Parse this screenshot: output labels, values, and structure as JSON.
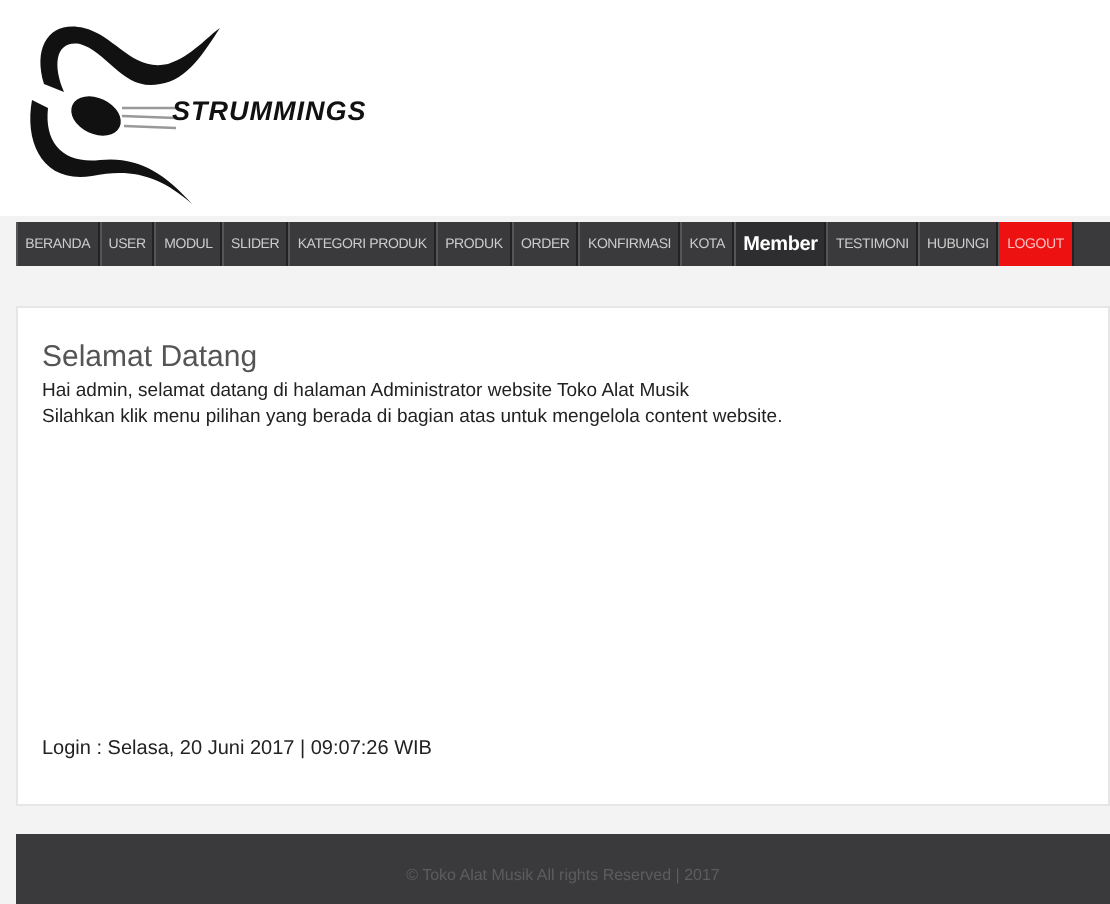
{
  "logo": {
    "text": "STRUMMINGS"
  },
  "nav": [
    {
      "label": "BERANDA",
      "selected": false,
      "kind": "link"
    },
    {
      "label": "USER",
      "selected": false,
      "kind": "link"
    },
    {
      "label": "MODUL",
      "selected": false,
      "kind": "link"
    },
    {
      "label": "SLIDER",
      "selected": false,
      "kind": "link"
    },
    {
      "label": "KATEGORI PRODUK",
      "selected": false,
      "kind": "link"
    },
    {
      "label": "PRODUK",
      "selected": false,
      "kind": "link"
    },
    {
      "label": "ORDER",
      "selected": false,
      "kind": "link"
    },
    {
      "label": "KONFIRMASI",
      "selected": false,
      "kind": "link"
    },
    {
      "label": "KOTA",
      "selected": false,
      "kind": "link"
    },
    {
      "label": "Member",
      "selected": true,
      "kind": "link"
    },
    {
      "label": "TESTIMONI",
      "selected": false,
      "kind": "link"
    },
    {
      "label": "HUBUNGI",
      "selected": false,
      "kind": "link"
    },
    {
      "label": "LOGOUT",
      "selected": false,
      "kind": "logout"
    }
  ],
  "content": {
    "title": "Selamat Datang",
    "lines": [
      "Hai admin, selamat datang di halaman Administrator website Toko Alat Musik",
      "Silahkan klik menu pilihan yang berada di bagian atas untuk mengelola content website."
    ],
    "login": "Login : Selasa, 20 Juni 2017 | 09:07:26 WIB"
  },
  "footer": "© Toko Alat Musik All rights Reserved | 2017"
}
